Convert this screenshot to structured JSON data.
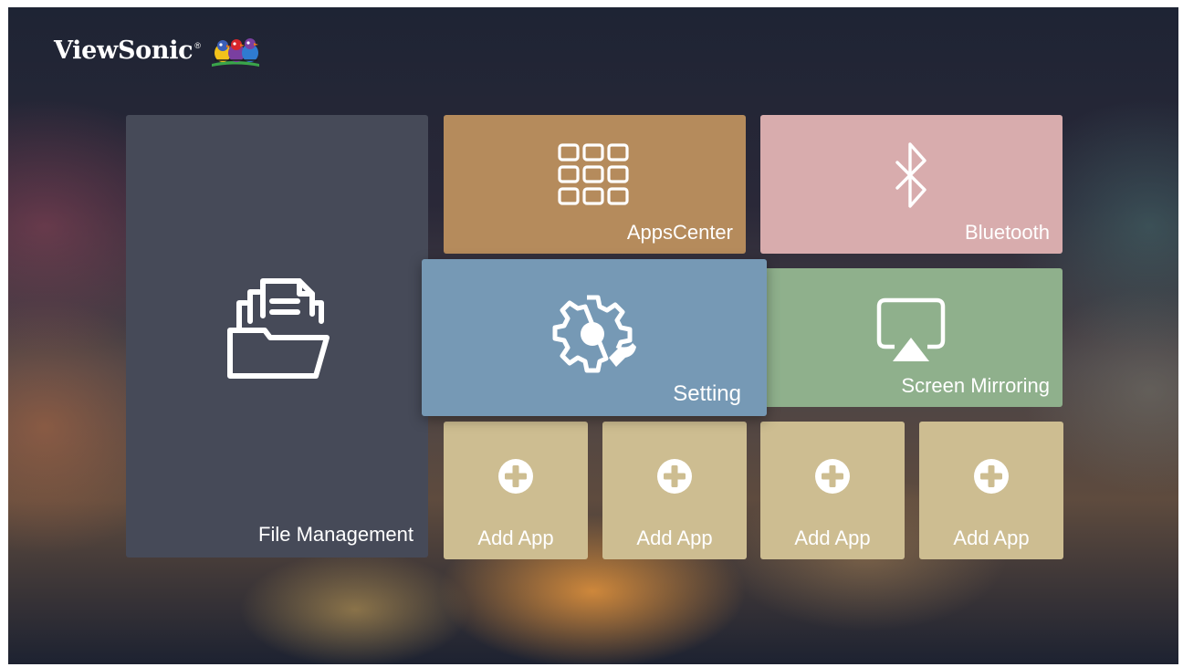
{
  "brand": {
    "name": "ViewSonic",
    "mark": "®"
  },
  "tiles": {
    "file_management": {
      "label": "File Management",
      "icon": "folder-documents-icon",
      "color": "#464a58"
    },
    "apps_center": {
      "label": "AppsCenter",
      "icon": "apps-grid-icon",
      "color": "#b58b5c"
    },
    "bluetooth": {
      "label": "Bluetooth",
      "icon": "bluetooth-icon",
      "color": "#d8acad"
    },
    "setting": {
      "label": "Setting",
      "icon": "gear-wrench-icon",
      "color": "#7699b5",
      "focused": true
    },
    "screen_mirroring": {
      "label": "Screen Mirroring",
      "icon": "airplay-icon",
      "color": "#8fb08c"
    },
    "add_apps": [
      {
        "label": "Add App",
        "icon": "plus-circle-icon"
      },
      {
        "label": "Add App",
        "icon": "plus-circle-icon"
      },
      {
        "label": "Add App",
        "icon": "plus-circle-icon"
      },
      {
        "label": "Add App",
        "icon": "plus-circle-icon"
      }
    ],
    "add_app_color": "#cdbd91"
  }
}
